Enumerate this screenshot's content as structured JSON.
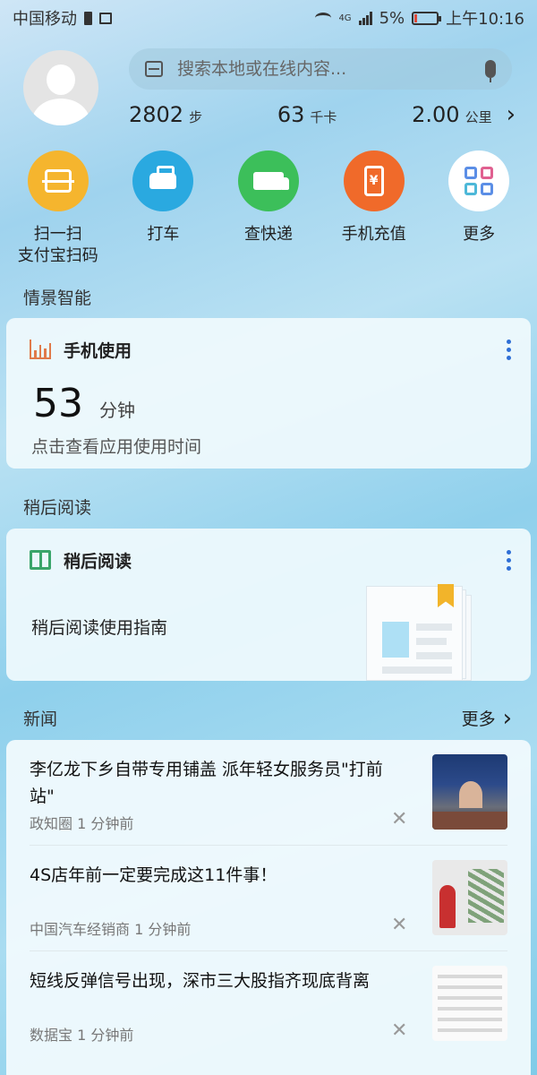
{
  "status_bar": {
    "carrier": "中国移动",
    "network": "4G",
    "battery": "5%",
    "time": "上午10:16"
  },
  "search": {
    "placeholder": "搜索本地或在线内容..."
  },
  "stats": {
    "steps_value": "2802",
    "steps_unit": "步",
    "calories_value": "63",
    "calories_unit": "千卡",
    "distance_value": "2.00",
    "distance_unit": "公里"
  },
  "actions": [
    {
      "label": "扫一扫\n支付宝扫码",
      "color": "#f5b52e",
      "icon": "scan-icon"
    },
    {
      "label": "打车",
      "color": "#2aa9e0",
      "icon": "taxi-icon"
    },
    {
      "label": "查快递",
      "color": "#3cbf5a",
      "icon": "truck-icon"
    },
    {
      "label": "手机充值",
      "color": "#f06a2a",
      "icon": "phone-recharge-icon"
    },
    {
      "label": "更多",
      "color": "#ffffff",
      "icon": "grid-more-icon"
    }
  ],
  "section_smart": "情景智能",
  "usage_card": {
    "title": "手机使用",
    "value": "53",
    "unit": "分钟",
    "subtitle": "点击查看应用使用时间"
  },
  "section_later": "稍后阅读",
  "later_card": {
    "title": "稍后阅读",
    "guide": "稍后阅读使用指南"
  },
  "news": {
    "title": "新闻",
    "more": "更多",
    "items": [
      {
        "headline": "李亿龙下乡自带专用铺盖 派年轻女服务员\"打前站\"",
        "source": "政知圈 1 分钟前"
      },
      {
        "headline": "4S店年前一定要完成这11件事！",
        "source": "中国汽车经销商 1 分钟前"
      },
      {
        "headline": "短线反弹信号出现，深市三大股指齐现底背离",
        "source": "数据宝 1 分钟前"
      }
    ]
  }
}
